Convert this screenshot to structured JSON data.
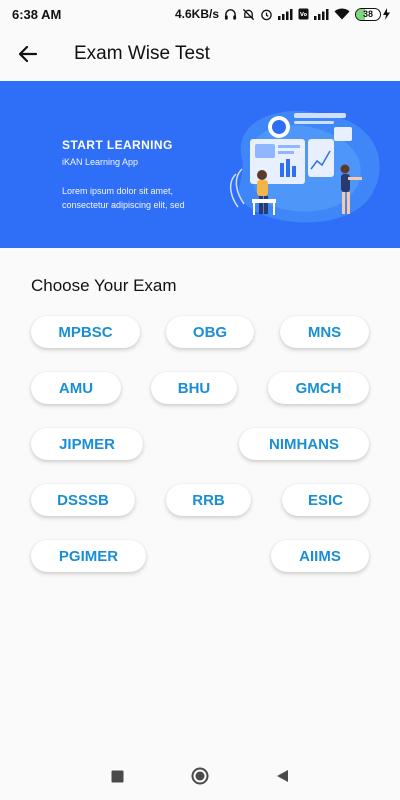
{
  "status_bar": {
    "time": "6:38 AM",
    "speed": "4.6KB/s",
    "battery": "38",
    "battery_level": 0.38
  },
  "app_bar": {
    "title": "Exam Wise Test",
    "back_icon": "arrow-left-icon"
  },
  "banner": {
    "title": "START LEARNING",
    "subtitle": "iKAN Learning App",
    "body": "Lorem ipsum dolor sit amet, consectetur adipiscing elit, sed",
    "background": "#2f6ef7"
  },
  "exams": {
    "title": "Choose Your Exam",
    "items": [
      "MPBSC",
      "OBG",
      "MNS",
      "AMU",
      "BHU",
      "GMCH",
      "JIPMER",
      "NIMHANS",
      "DSSSB",
      "RRB",
      "ESIC",
      "PGIMER",
      "AIIMS"
    ],
    "chip_text_color": "#1b8fd4"
  },
  "nav_bar": {
    "recent_icon": "square-icon",
    "home_icon": "circle-icon",
    "back_icon": "triangle-back-icon"
  }
}
